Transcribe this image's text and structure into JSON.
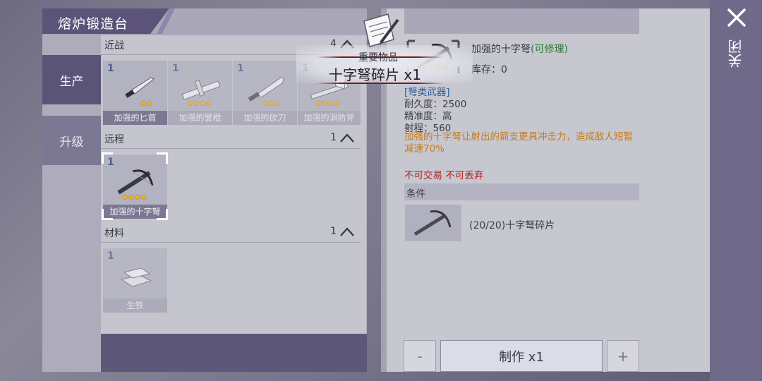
{
  "title": "熔炉锻造台",
  "nav": {
    "produce": "生产",
    "upgrade": "升级"
  },
  "close": {
    "label": "关闭"
  },
  "sections": {
    "melee": {
      "label": "近战",
      "count": "4"
    },
    "ranged": {
      "label": "远程",
      "count": "1"
    },
    "material": {
      "label": "材料",
      "count": "1"
    }
  },
  "items": {
    "melee": [
      {
        "qty": "1",
        "name": "加强的匕首",
        "stars": "★★"
      },
      {
        "qty": "1",
        "name": "加强的警棍",
        "stars": "★★★★"
      },
      {
        "qty": "1",
        "name": "加强的砍刀",
        "stars": "★★★"
      },
      {
        "qty": "1",
        "name": "加强的消防斧",
        "stars": "★★★★"
      }
    ],
    "ranged": [
      {
        "qty": "1",
        "name": "加强的十字弩",
        "stars": "★★★★"
      }
    ],
    "material": [
      {
        "qty": "1",
        "name": "生铁"
      }
    ]
  },
  "popup": {
    "subtitle": "重要物品",
    "title": "十字弩碎片 x1"
  },
  "detail": {
    "name": "加强的十字弩",
    "repairable": "(可修理)",
    "stars": "★★★★",
    "stock": "库存：0",
    "category": "[弩类武器]",
    "durability": "耐久度：2500",
    "accuracy": "精准度：高",
    "range": "射程：560",
    "description": "加强的十字弩让射出的箭支更具冲击力，造成敌人短暂减速70%",
    "restriction": "不可交易 不可丢弃",
    "condition_label": "条件",
    "condition_text": "(20/20)十字弩碎片"
  },
  "controls": {
    "minus": "-",
    "make": "制作 x1",
    "plus": "+"
  },
  "colors": {
    "accent": "#5b5478",
    "star": "#f1b62a",
    "category": "#2f5ea4",
    "description": "#c87a14",
    "warning": "#b61d1d",
    "repairable": "#2f7a3a"
  },
  "icons": {
    "close": "close-icon",
    "note": "note-pencil-icon",
    "chevron": "chevron-up-icon",
    "crossbow": "crossbow-icon",
    "dagger": "dagger-icon",
    "baton": "baton-icon",
    "machete": "machete-icon",
    "axe": "fire-axe-icon",
    "iron": "iron-ingot-icon"
  }
}
